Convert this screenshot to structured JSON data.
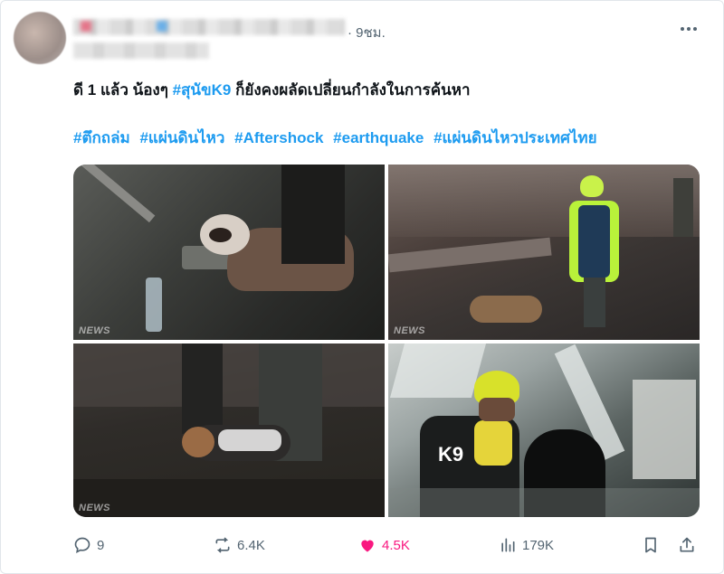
{
  "post": {
    "time": "· 9ชม.",
    "line1_prefix": "ดี 1 แล้ว น้องๆ ",
    "line1_tag": "#สุนัขK9",
    "line1_suffix": " ก็ยังคงผลัดเปลี่ยนกำลังในการค้นหา",
    "hashtags": [
      "#ตึกถล่ม",
      "#แผ่นดินไหว",
      "#Aftershock",
      "#earthquake",
      "#แผ่นดินไหวประเทศไทย"
    ]
  },
  "media": {
    "watermark": "NEWS",
    "vest_text": "K9"
  },
  "actions": {
    "replies": "9",
    "reposts": "6.4K",
    "likes": "4.5K",
    "views": "179K"
  },
  "colors": {
    "accent": "#1d9bf0",
    "like": "#f91880",
    "muted": "#536471"
  }
}
